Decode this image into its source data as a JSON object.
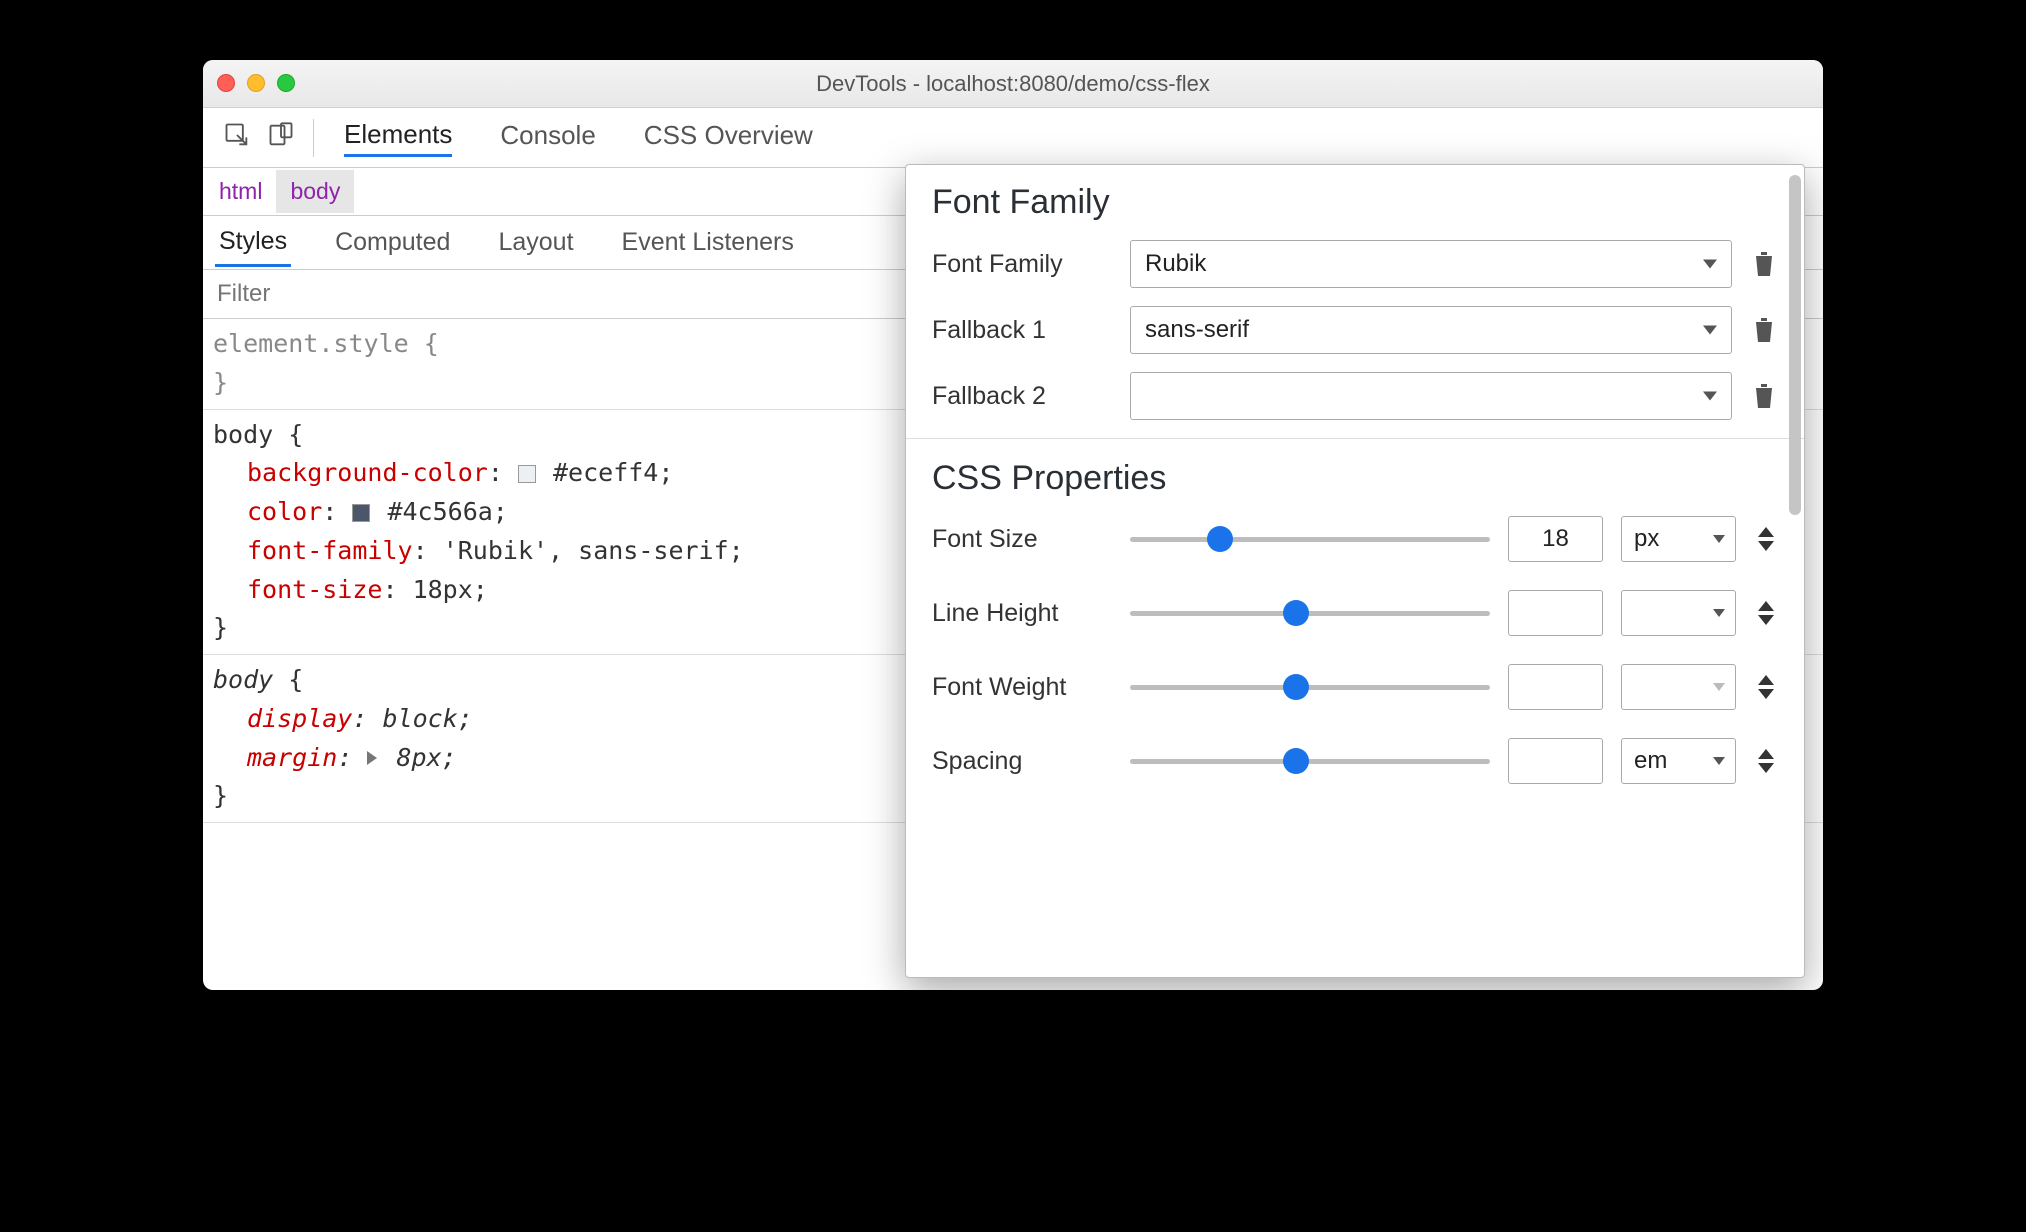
{
  "window": {
    "title": "DevTools - localhost:8080/demo/css-flex"
  },
  "tabs": {
    "elements": "Elements",
    "console": "Console",
    "css_overview": "CSS Overview"
  },
  "breadcrumbs": {
    "html": "html",
    "body": "body"
  },
  "subtabs": {
    "styles": "Styles",
    "computed": "Computed",
    "layout": "Layout",
    "event_listeners": "Event Listeners"
  },
  "filter": {
    "placeholder": "Filter"
  },
  "rules": {
    "element_style": {
      "selector": "element.style",
      "open": "{",
      "close": "}"
    },
    "body1": {
      "selector": "body",
      "open": "{",
      "close": "}",
      "decls": {
        "bg": {
          "prop": "background-color",
          "val": "#eceff4",
          "swatch": "#eceff4"
        },
        "col": {
          "prop": "color",
          "val": "#4c566a",
          "swatch": "#4c566a"
        },
        "ff": {
          "prop": "font-family",
          "val": "'Rubik', sans-serif"
        },
        "fs": {
          "prop": "font-size",
          "val": "18px"
        }
      }
    },
    "body2": {
      "selector": "body",
      "open": "{",
      "close": "}",
      "decls": {
        "disp": {
          "prop": "display",
          "val": "block"
        },
        "marg": {
          "prop": "margin",
          "val": "8px"
        }
      }
    }
  },
  "font_panel": {
    "family_heading": "Font Family",
    "props_heading": "CSS Properties",
    "family_rows": {
      "main": {
        "label": "Font Family",
        "value": "Rubik"
      },
      "fb1": {
        "label": "Fallback 1",
        "value": "sans-serif"
      },
      "fb2": {
        "label": "Fallback 2",
        "value": ""
      }
    },
    "props": {
      "font_size": {
        "label": "Font Size",
        "value": "18",
        "unit": "px",
        "thumb_pct": 25
      },
      "line_height": {
        "label": "Line Height",
        "value": "",
        "unit": "",
        "thumb_pct": 46
      },
      "font_weight": {
        "label": "Font Weight",
        "value": "",
        "unit": "",
        "thumb_pct": 46,
        "unit_disabled": true
      },
      "spacing": {
        "label": "Spacing",
        "value": "",
        "unit": "em",
        "thumb_pct": 46
      }
    }
  }
}
